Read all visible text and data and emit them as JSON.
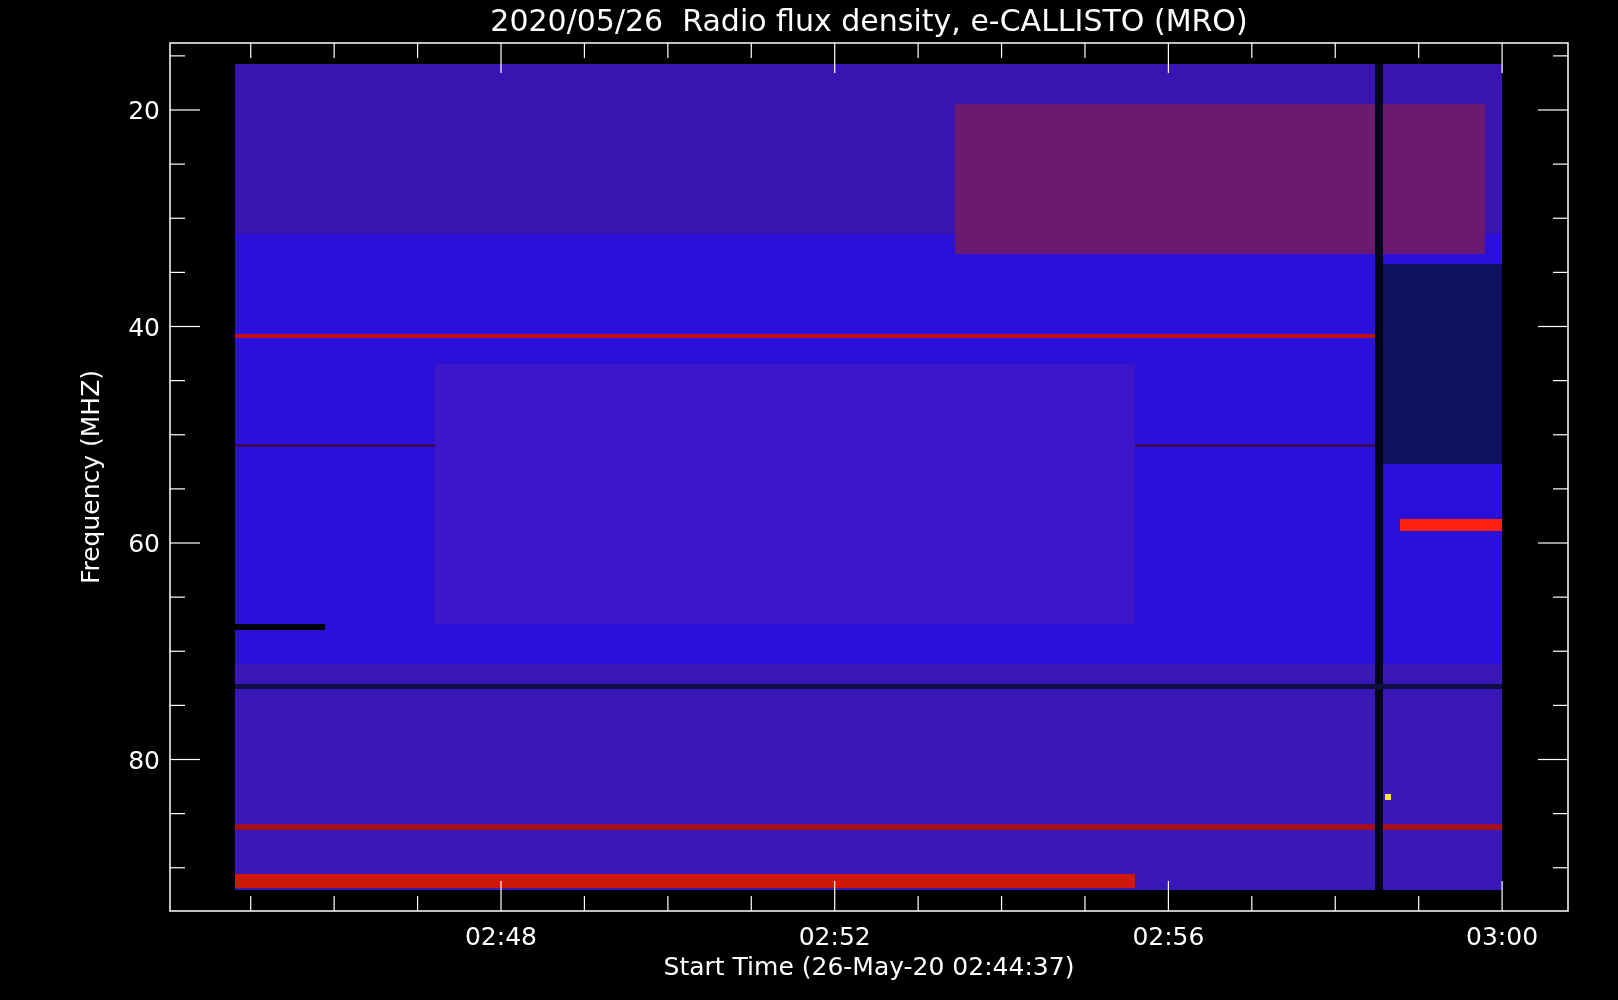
{
  "plot": {
    "title": "2020/05/26  Radio flux density, e-CALLISTO (MRO)",
    "xlabel": "Start Time (26-May-20 02:44:37)",
    "ylabel": "Frequency (MHZ)",
    "xticks": [
      "02:48",
      "02:52",
      "02:56",
      "03:00"
    ],
    "yticks": [
      "20",
      "40",
      "60",
      "80"
    ]
  }
}
